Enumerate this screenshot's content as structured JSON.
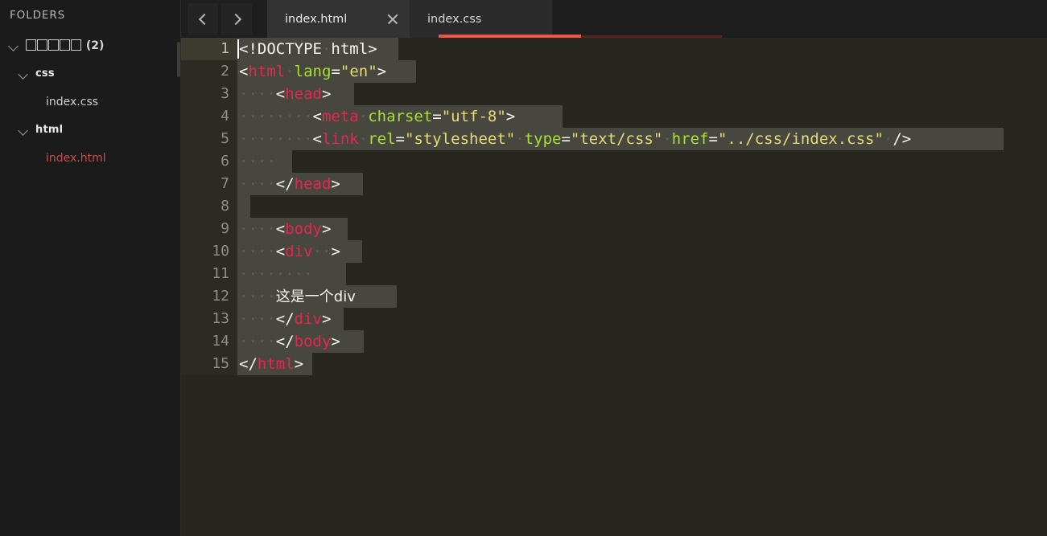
{
  "sidebar": {
    "title": "FOLDERS",
    "root": {
      "name_tofu_count": 5,
      "suffix": "(2)",
      "expanded": true
    },
    "folders": [
      {
        "name": "css",
        "expanded": true,
        "files": [
          {
            "name": "index.css",
            "active": false
          }
        ]
      },
      {
        "name": "html",
        "expanded": true,
        "files": [
          {
            "name": "index.html",
            "active": true
          }
        ]
      }
    ]
  },
  "tabbar": {
    "nav_back": "‹",
    "nav_forward": "›",
    "tabs": [
      {
        "label": "index.html",
        "active": true,
        "closable": true
      },
      {
        "label": "index.css",
        "active": false,
        "closable": false
      }
    ],
    "active_underline_color": "#f4534a",
    "rest_underline_color": "#58241c"
  },
  "editor": {
    "current_line": 1,
    "colors": {
      "background": "#272720",
      "gutter": "#2b2b24",
      "gutter_current": "#3b3b30",
      "selection": "#474740",
      "tag": "#e8254f",
      "attribute": "#a6e22e",
      "value": "#e6db74",
      "punctuation": "#f5f5ee",
      "whitespace_dot": "#5d5d52",
      "line_number": "#8e8e82"
    },
    "lines": [
      {
        "num": 1,
        "sel_width": 200,
        "cursor": true,
        "tokens": [
          {
            "c": "t-doctype",
            "s": "<!DOCTYPE"
          },
          {
            "c": "ws",
            "s": "·"
          },
          {
            "c": "t-doctype",
            "s": "html>"
          }
        ]
      },
      {
        "num": 2,
        "sel_width": 222,
        "tokens": [
          {
            "c": "t-punc",
            "s": "<"
          },
          {
            "c": "t-tag",
            "s": "html"
          },
          {
            "c": "ws",
            "s": "·"
          },
          {
            "c": "t-attr",
            "s": "lang"
          },
          {
            "c": "t-punc",
            "s": "="
          },
          {
            "c": "t-val",
            "s": "\"en\""
          },
          {
            "c": "t-punc",
            "s": ">"
          }
        ]
      },
      {
        "num": 3,
        "sel_width": 145,
        "tokens": [
          {
            "c": "ws",
            "s": "····"
          },
          {
            "c": "t-punc",
            "s": "<"
          },
          {
            "c": "t-tag",
            "s": "head"
          },
          {
            "c": "t-punc",
            "s": ">"
          }
        ]
      },
      {
        "num": 4,
        "sel_width": 404,
        "tokens": [
          {
            "c": "ws",
            "s": "········"
          },
          {
            "c": "t-punc",
            "s": "<"
          },
          {
            "c": "t-tag",
            "s": "meta"
          },
          {
            "c": "ws",
            "s": "·"
          },
          {
            "c": "t-attr",
            "s": "charset"
          },
          {
            "c": "t-punc",
            "s": "="
          },
          {
            "c": "t-val",
            "s": "\"utf-8\""
          },
          {
            "c": "t-punc",
            "s": ">"
          }
        ]
      },
      {
        "num": 5,
        "sel_width": 952,
        "tokens": [
          {
            "c": "ws",
            "s": "········"
          },
          {
            "c": "t-punc",
            "s": "<"
          },
          {
            "c": "t-tag",
            "s": "link"
          },
          {
            "c": "ws",
            "s": "·"
          },
          {
            "c": "t-attr",
            "s": "rel"
          },
          {
            "c": "t-punc",
            "s": "="
          },
          {
            "c": "t-val",
            "s": "\"stylesheet\""
          },
          {
            "c": "ws",
            "s": "·"
          },
          {
            "c": "t-attr",
            "s": "type"
          },
          {
            "c": "t-punc",
            "s": "="
          },
          {
            "c": "t-val",
            "s": "\"text/css\""
          },
          {
            "c": "ws",
            "s": "·"
          },
          {
            "c": "t-attr",
            "s": "href"
          },
          {
            "c": "t-punc",
            "s": "="
          },
          {
            "c": "t-val",
            "s": "\"../css/index.css\""
          },
          {
            "c": "ws",
            "s": "·"
          },
          {
            "c": "t-punc",
            "s": "/>"
          }
        ]
      },
      {
        "num": 6,
        "sel_width": 68,
        "tokens": [
          {
            "c": "ws",
            "s": "····"
          }
        ]
      },
      {
        "num": 7,
        "sel_width": 156,
        "tokens": [
          {
            "c": "ws",
            "s": "····"
          },
          {
            "c": "t-punc",
            "s": "</"
          },
          {
            "c": "t-tag",
            "s": "head"
          },
          {
            "c": "t-punc",
            "s": ">"
          }
        ]
      },
      {
        "num": 8,
        "sel_width": 16,
        "tokens": []
      },
      {
        "num": 9,
        "sel_width": 137,
        "tokens": [
          {
            "c": "ws",
            "s": "····"
          },
          {
            "c": "t-punc",
            "s": "<"
          },
          {
            "c": "t-tag",
            "s": "body"
          },
          {
            "c": "t-punc",
            "s": ">"
          }
        ]
      },
      {
        "num": 10,
        "sel_width": 155,
        "tokens": [
          {
            "c": "ws",
            "s": "····"
          },
          {
            "c": "t-punc",
            "s": "<"
          },
          {
            "c": "t-tag",
            "s": "div"
          },
          {
            "c": "ws",
            "s": "··"
          },
          {
            "c": "t-punc",
            "s": ">"
          }
        ]
      },
      {
        "num": 11,
        "sel_width": 135,
        "tokens": [
          {
            "c": "ws",
            "s": "········"
          }
        ]
      },
      {
        "num": 12,
        "sel_width": 198,
        "tokens": [
          {
            "c": "ws",
            "s": "····"
          },
          {
            "c": "t-text cjk",
            "s": "这是一个div"
          }
        ]
      },
      {
        "num": 13,
        "sel_width": 132,
        "tokens": [
          {
            "c": "ws",
            "s": "····"
          },
          {
            "c": "t-punc",
            "s": "</"
          },
          {
            "c": "t-tag",
            "s": "div"
          },
          {
            "c": "t-punc",
            "s": ">"
          }
        ]
      },
      {
        "num": 14,
        "sel_width": 157,
        "tokens": [
          {
            "c": "ws",
            "s": "····"
          },
          {
            "c": "t-punc",
            "s": "</"
          },
          {
            "c": "t-tag",
            "s": "body"
          },
          {
            "c": "t-punc",
            "s": ">"
          }
        ]
      },
      {
        "num": 15,
        "sel_width": 93,
        "tokens": [
          {
            "c": "t-punc",
            "s": "</"
          },
          {
            "c": "t-tag",
            "s": "html"
          },
          {
            "c": "t-punc",
            "s": ">"
          }
        ]
      }
    ]
  }
}
